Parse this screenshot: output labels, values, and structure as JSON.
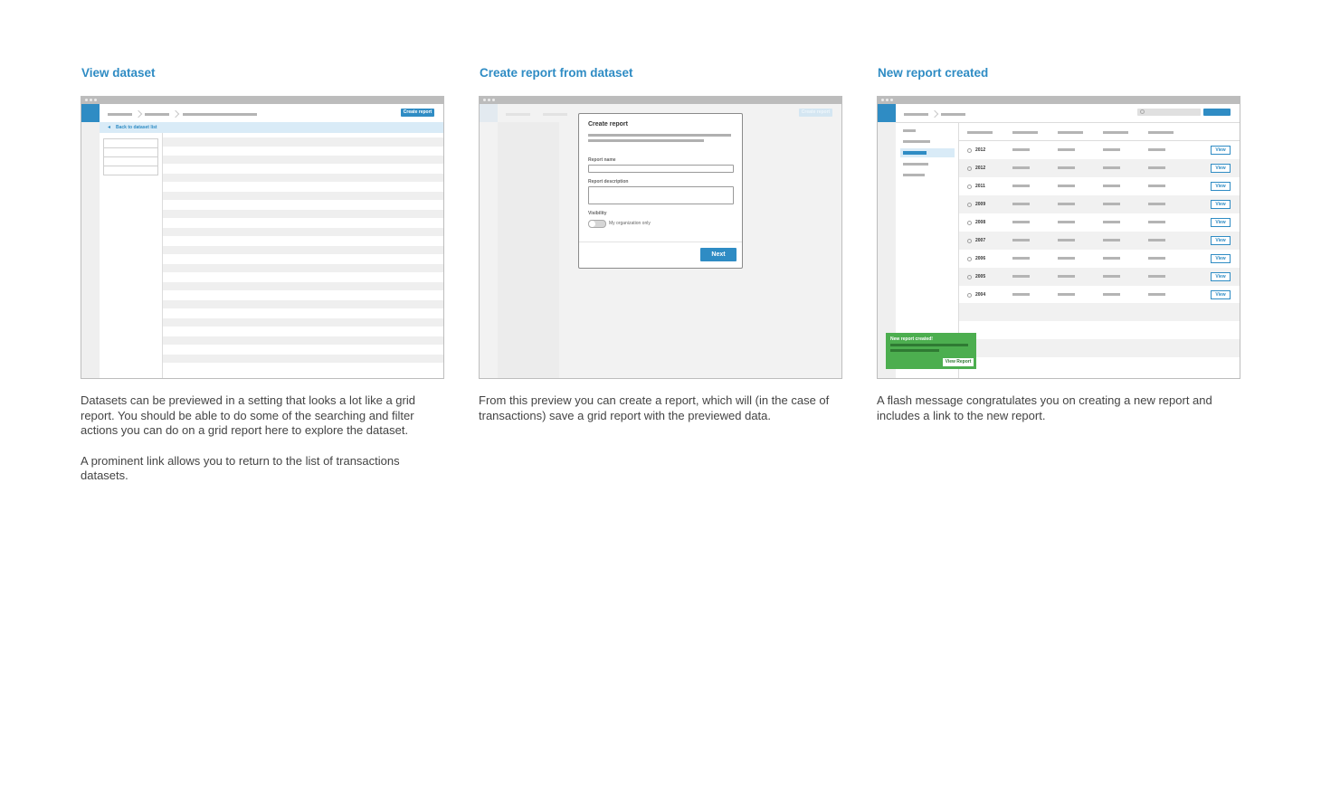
{
  "colors": {
    "accent": "#2f8cc4",
    "success": "#4cae4f",
    "stripe": "#efefef"
  },
  "panels": [
    {
      "title": "View dataset",
      "mock": {
        "create_button": "Create report",
        "back_link": "Back to dataset list"
      },
      "description": [
        "Datasets can be previewed in a setting that looks a lot like a grid report. You should be able to do some of the searching and filter actions you can do on a grid report here to explore the dataset.",
        "A prominent link allows you to return to the list of transactions datasets."
      ]
    },
    {
      "title": "Create report from dataset",
      "mock": {
        "create_button": "Create report",
        "modal_title": "Create report",
        "field_name_label": "Report name",
        "field_description_label": "Report description",
        "visibility_label": "Visibility",
        "toggle_label": "My organization only",
        "next_button": "Next"
      },
      "description": [
        "From this preview you can create a report, which will (in the case of transactions) save a grid report with the previewed data."
      ]
    },
    {
      "title": "New report created",
      "mock": {
        "search_icon": "search-icon",
        "years": [
          "2012",
          "2012",
          "2011",
          "2009",
          "2008",
          "2007",
          "2006",
          "2005",
          "2004"
        ],
        "view_button": "View",
        "flash_title": "New report created!",
        "flash_button": "View Report"
      },
      "description": [
        "A flash message congratulates you on creating a new report and includes a link to the new report."
      ]
    }
  ]
}
